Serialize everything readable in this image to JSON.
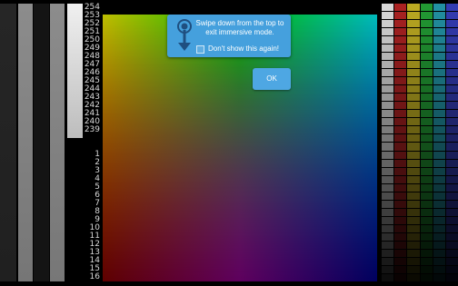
{
  "ramp": {
    "top_labels": [
      "254",
      "253",
      "252",
      "251",
      "250",
      "249",
      "248",
      "247",
      "246",
      "245",
      "244",
      "243",
      "242",
      "241",
      "240",
      "239"
    ],
    "bottom_labels": [
      "1",
      "2",
      "3",
      "4",
      "5",
      "6",
      "7",
      "8",
      "9",
      "10",
      "11",
      "12",
      "13",
      "14",
      "15",
      "16"
    ]
  },
  "immersive_notice": {
    "message": "Swipe down from the top to exit immersive mode.",
    "dont_show_label": "Don't show this again!",
    "ok_label": "OK"
  },
  "icons": {
    "swipe": "swipe-down-icon",
    "checkbox": "checkbox-icon"
  },
  "colors": {
    "toast_background": "#45a0dd",
    "ok_button": "#4ea7e3",
    "page_background": "#000000"
  }
}
